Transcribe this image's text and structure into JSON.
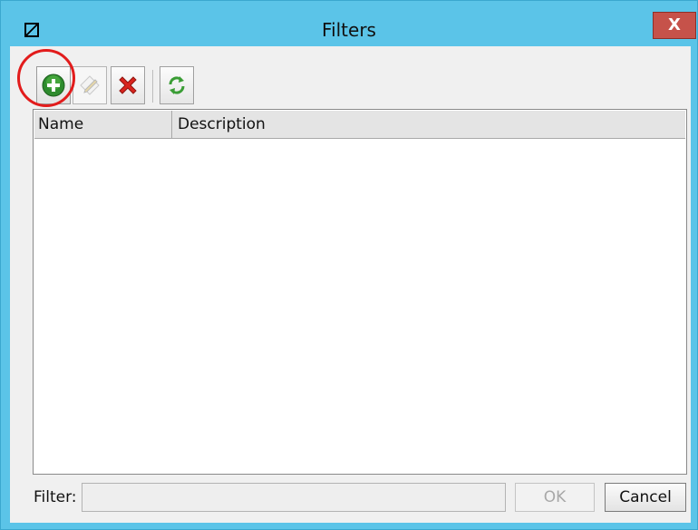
{
  "window": {
    "title": "Filters",
    "close_label": "X",
    "frame_color": "#5bc4e8"
  },
  "toolbar": {
    "buttons": [
      {
        "name": "add",
        "icon": "plus-circle-icon",
        "color": "#2e8b2e"
      },
      {
        "name": "edit",
        "icon": "pencil-edit-icon",
        "enabled": false
      },
      {
        "name": "delete",
        "icon": "red-x-icon",
        "color": "#d9241e"
      },
      {
        "name": "refresh",
        "icon": "refresh-arrows-icon",
        "color": "#3a9d35"
      }
    ],
    "highlight_color": "#e21c1c"
  },
  "table": {
    "columns": [
      "Name",
      "Description"
    ],
    "rows": []
  },
  "footer": {
    "filter_label": "Filter:",
    "filter_value": "",
    "ok_label": "OK",
    "cancel_label": "Cancel"
  }
}
